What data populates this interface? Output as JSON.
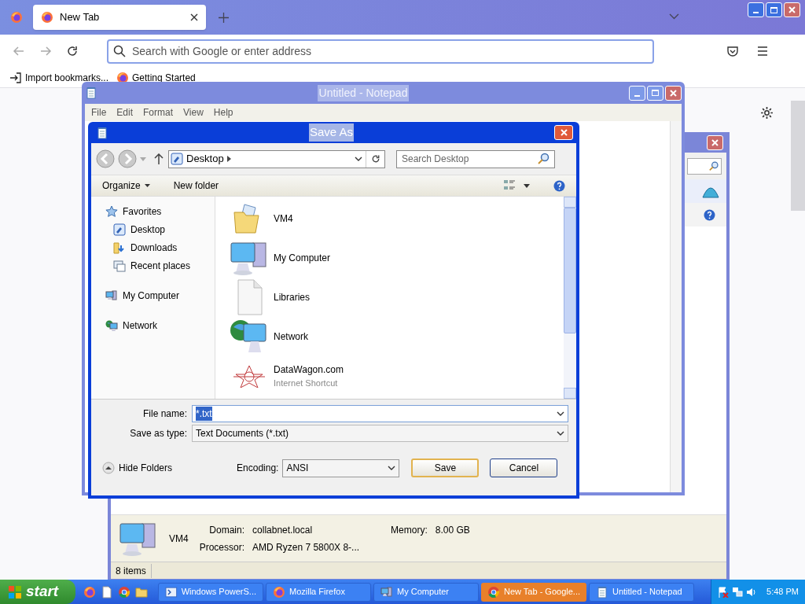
{
  "browser": {
    "tabs": [
      {
        "label": "New Tab",
        "selected": true
      }
    ],
    "address_placeholder": "Search with Google or enter address",
    "bookmarks": [
      {
        "label": "Import bookmarks...",
        "kind": "import"
      },
      {
        "label": "Getting Started",
        "kind": "firefox"
      }
    ]
  },
  "my_computer": {
    "details": {
      "name": "VM4",
      "rows": [
        [
          {
            "label": "Domain:",
            "value": "collabnet.local"
          },
          {
            "label": "Memory:",
            "value": "8.00 GB"
          }
        ],
        [
          {
            "label": "Processor:",
            "value": "AMD Ryzen 7 5800X 8-..."
          }
        ]
      ]
    },
    "status": "8 items"
  },
  "notepad": {
    "title": "Untitled - Notepad",
    "menu": [
      "File",
      "Edit",
      "Format",
      "View",
      "Help"
    ]
  },
  "save_as": {
    "title": "Save As",
    "location": "Desktop",
    "search_placeholder": "Search Desktop",
    "toolbar": [
      "Organize",
      "New folder"
    ],
    "nav": [
      {
        "label": "Favorites",
        "kind": "favorites",
        "children": [
          {
            "label": "Desktop",
            "kind": "desktop"
          },
          {
            "label": "Downloads",
            "kind": "downloads"
          },
          {
            "label": "Recent places",
            "kind": "recent"
          }
        ]
      },
      {
        "label": "My Computer",
        "kind": "computer"
      },
      {
        "label": "Network",
        "kind": "network"
      }
    ],
    "items": [
      {
        "name": "VM4",
        "kind": "folder"
      },
      {
        "name": "My Computer",
        "kind": "computer"
      },
      {
        "name": "Libraries",
        "kind": "file"
      },
      {
        "name": "Network",
        "kind": "network"
      },
      {
        "name": "DataWagon.com",
        "subtitle": "Internet Shortcut",
        "kind": "shortcut"
      }
    ],
    "file_name_label": "File name:",
    "file_name": "*.txt",
    "type_label": "Save as type:",
    "type": "Text Documents (*.txt)",
    "hide_folders": "Hide Folders",
    "encoding_label": "Encoding:",
    "encoding": "ANSI",
    "buttons": [
      {
        "label": "Save",
        "default": true
      },
      {
        "label": "Cancel",
        "default": false
      }
    ]
  },
  "taskbar": {
    "start": "start",
    "tasks": [
      {
        "label": "Windows PowerS...",
        "kind": "powershell",
        "selected": false
      },
      {
        "label": "Mozilla Firefox",
        "kind": "firefox",
        "selected": false
      },
      {
        "label": "My Computer",
        "kind": "computer",
        "selected": false
      },
      {
        "label": "New Tab - Google...",
        "kind": "chrome",
        "selected": true
      },
      {
        "label": "Untitled - Notepad",
        "kind": "notepad",
        "selected": false
      }
    ],
    "clock": "5:48 PM"
  }
}
